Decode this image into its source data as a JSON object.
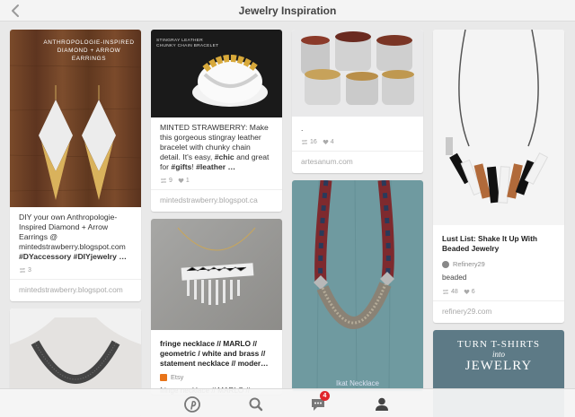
{
  "header": {
    "title": "Jewelry Inspiration"
  },
  "col1": {
    "pin1": {
      "overlay_line1": "ANTHROPOLOGIE-INSPIRED",
      "overlay_line2": "DIAMOND + ARROW EARRINGS",
      "desc_plain": "DIY your own Anthropologie-Inspired Diamond + Arrow Earrings @ mintedstrawberry.blogspot.com ",
      "desc_bold": "#DYaccessory #DIYjewelry …",
      "repins": "3",
      "source": "mintedstrawberry.blogspot.com"
    }
  },
  "col2": {
    "pin1": {
      "img_caption": "STINGRAY LEATHER CHUNKY CHAIN BRACELET",
      "desc_a": "MINTED STRAWBERRY: Make this gorgeous stingray leather bracelet with chunky chain detail. It's easy, ",
      "tag_chic": "#chic",
      "desc_b": " and great for ",
      "tag_gifts": "#gifts",
      "desc_c": "! ",
      "tag_leather": "#leather …",
      "repins": "9",
      "likes": "1",
      "source": "mintedstrawberry.blogspot.ca"
    },
    "pin2": {
      "title": "fringe necklace // MARLO // geometric / white and brass // statement necklace // moder…",
      "via": "Etsy",
      "desc": "fringe necklace // MARLO //"
    }
  },
  "col3": {
    "pin1": {
      "desc": ".",
      "repins": "16",
      "likes": "4",
      "source": "artesanum.com"
    },
    "pin2": {
      "bottom_text": "Ikat Necklace"
    }
  },
  "col4": {
    "pin1": {
      "title": "Lust List: Shake It Up With Beaded Jewelry",
      "via": "Refinery29",
      "desc": "beaded",
      "repins": "48",
      "likes": "6",
      "source": "refinery29.com"
    },
    "pin2": {
      "line1": "TURN T-SHIRTS",
      "line2": "into",
      "line3": "JEWELRY"
    }
  },
  "tabbar": {
    "notification_count": "4"
  },
  "colors": {
    "accent": "#e0262c",
    "etsy": "#e8741a"
  }
}
